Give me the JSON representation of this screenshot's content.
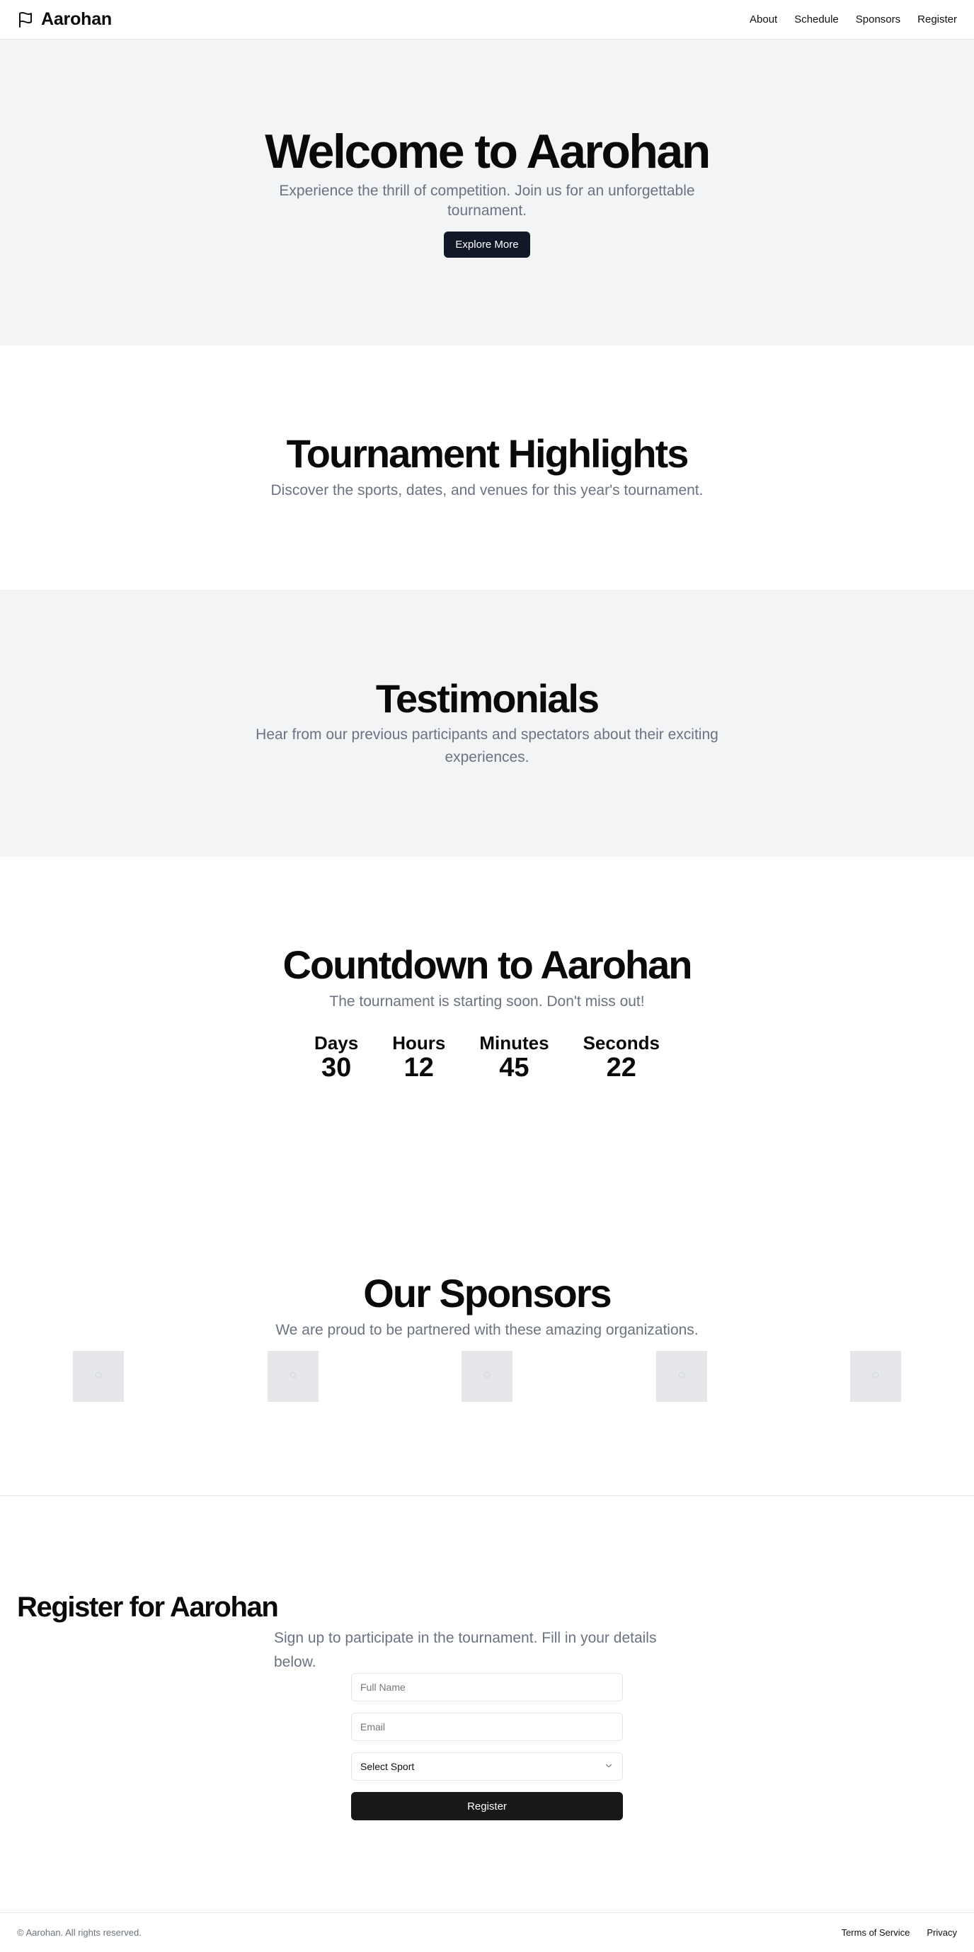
{
  "header": {
    "brand": "Aarohan",
    "brand_icon": "flag-icon",
    "nav": [
      "About",
      "Schedule",
      "Sponsors",
      "Register"
    ]
  },
  "hero": {
    "title": "Welcome to Aarohan",
    "subtitle": "Experience the thrill of competition. Join us for an unforgettable tournament.",
    "cta": "Explore More"
  },
  "highlights": {
    "title": "Tournament Highlights",
    "subtitle": "Discover the sports, dates, and venues for this year's tournament."
  },
  "testimonials": {
    "title": "Testimonials",
    "subtitle": "Hear from our previous participants and spectators about their exciting experiences."
  },
  "countdown": {
    "title": "Countdown to Aarohan",
    "subtitle": "The tournament is starting soon. Don't miss out!",
    "units": [
      {
        "label": "Days",
        "value": "30"
      },
      {
        "label": "Hours",
        "value": "12"
      },
      {
        "label": "Minutes",
        "value": "45"
      },
      {
        "label": "Seconds",
        "value": "22"
      }
    ]
  },
  "sponsors": {
    "title": "Our Sponsors",
    "subtitle": "We are proud to be partnered with these amazing organizations.",
    "logos": [
      "image-placeholder-icon",
      "image-placeholder-icon",
      "image-placeholder-icon",
      "image-placeholder-icon",
      "image-placeholder-icon"
    ]
  },
  "register": {
    "title": "Register for Aarohan",
    "subtitle": "Sign up to participate in the tournament. Fill in your details below.",
    "name_placeholder": "Full Name",
    "email_placeholder": "Email",
    "sport_select": "Select Sport",
    "submit": "Register"
  },
  "footer": {
    "copyright": "© Aarohan. All rights reserved.",
    "links": [
      "Terms of Service",
      "Privacy"
    ]
  }
}
